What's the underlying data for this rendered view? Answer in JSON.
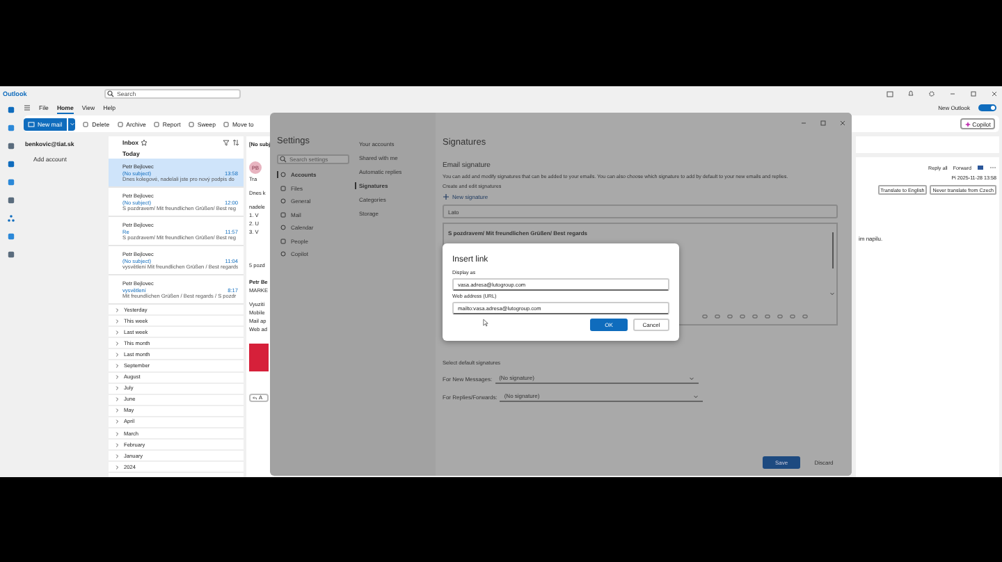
{
  "app": {
    "name": "Outlook",
    "search": {
      "placeholder": "Search"
    }
  },
  "menu": [
    {
      "label": "File",
      "selected": false
    },
    {
      "label": "Home",
      "selected": true
    },
    {
      "label": "View",
      "selected": false
    },
    {
      "label": "Help",
      "selected": false
    }
  ],
  "new_outlook": {
    "label": "New Outlook",
    "on": true
  },
  "ribbon": {
    "new_mail": "New mail",
    "actions": [
      "Delete",
      "Archive",
      "Report",
      "Sweep",
      "Move to"
    ],
    "copilot": "Copilot"
  },
  "folders": {
    "account": "benkovic@tiat.sk",
    "add_account": "Add account"
  },
  "inbox": {
    "title": "Inbox",
    "today": "Today",
    "messages": [
      {
        "sender": "Petr Bejlovec",
        "subject": "(No subject)",
        "time": "13:58",
        "preview": "Dnes kolegové, nadelali jste pro nový podpis do",
        "selected": true
      },
      {
        "sender": "Petr Bejlovec",
        "subject": "(No subject)",
        "time": "12:00",
        "preview": "S pozdravem/ Mit freundlichen Grüßen/ Best reg",
        "selected": false
      },
      {
        "sender": "Petr Bejlovec",
        "subject": "Re",
        "time": "11:57",
        "preview": "S pozdravem/ Mit freundlichen Grüßen/ Best reg",
        "selected": false
      },
      {
        "sender": "Petr Bejlovec",
        "subject": "(No subject)",
        "time": "11:04",
        "preview": "vysvětlení Mit freundlichen Grüßen / Best regards",
        "selected": false
      },
      {
        "sender": "Petr Bejlovec",
        "subject": "vysvětlení",
        "time": "8:17",
        "preview": "Mit freundlichen Grüßen / Best regards / S pozdr",
        "selected": false
      }
    ],
    "groups": [
      "Yesterday",
      "This week",
      "Last week",
      "This month",
      "Last month",
      "September",
      "August",
      "July",
      "June",
      "May",
      "April",
      "March",
      "February",
      "January",
      "2024"
    ]
  },
  "reading": {
    "left": {
      "subject": "[No subj",
      "avatar": "PB",
      "translate": "Tra",
      "lines": [
        "Dnes k",
        "nadele"
      ],
      "list": [
        "1. V",
        "2. U",
        "3. V"
      ],
      "closing": "5 pozd",
      "signature_name": "Petr Be",
      "signature_role": "MARKE",
      "signature_lines": [
        "Vyuziti",
        "Mobile",
        "Mail ap",
        "Web ad"
      ],
      "reply": "A"
    },
    "right": {
      "actions": [
        "Reply all",
        "Forward"
      ],
      "date": "Pi 2025-11-28 13:58",
      "translate": [
        "Translate to English",
        "Never translate from Czech"
      ],
      "body": "im napilu."
    }
  },
  "settings": {
    "title": "Settings",
    "search": {
      "placeholder": "Search settings"
    },
    "nav": [
      {
        "label": "Accounts",
        "selected": true
      },
      {
        "label": "Files",
        "selected": false
      },
      {
        "label": "General",
        "selected": false
      },
      {
        "label": "Mail",
        "selected": false
      },
      {
        "label": "Calendar",
        "selected": false
      },
      {
        "label": "People",
        "selected": false
      },
      {
        "label": "Copilot",
        "selected": false
      }
    ],
    "subnav": [
      {
        "label": "Your accounts",
        "selected": false
      },
      {
        "label": "Shared with me",
        "selected": false
      },
      {
        "label": "Automatic replies",
        "selected": false
      },
      {
        "label": "Signatures",
        "selected": true
      },
      {
        "label": "Categories",
        "selected": false
      },
      {
        "label": "Storage",
        "selected": false
      }
    ],
    "heading": "Signatures",
    "section": "Email signature",
    "description": "You can add and modify signatures that can be added to your emails. You can also choose which signature to add by default to your new emails and replies.",
    "create_label": "Create and edit signatures",
    "new_signature": "New signature",
    "name_value": "Lato",
    "signature_text": "S pozdravem/ Mit freundlichen Grüßen/ Best regards",
    "defaults_title": "Select default signatures",
    "defaults": [
      {
        "label": "For New Messages:",
        "value": "(No signature)"
      },
      {
        "label": "For Replies/Forwards:",
        "value": "(No signature)"
      }
    ],
    "save": "Save",
    "discard": "Discard"
  },
  "insert_link": {
    "title": "Insert link",
    "fields": [
      {
        "label": "Display as",
        "value": "vasa.adresa@lutogroup.com"
      },
      {
        "label": "Web address (URL)",
        "value": "mailto:vasa.adresa@lutogroup.com"
      }
    ],
    "ok": "OK",
    "cancel": "Cancel"
  }
}
